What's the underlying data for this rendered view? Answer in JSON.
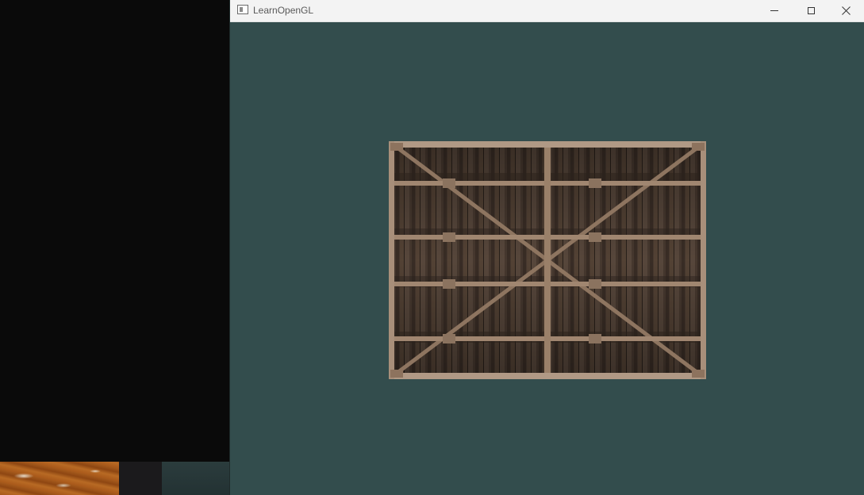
{
  "window": {
    "title": "LearnOpenGL",
    "controls": {
      "minimize": "minimize",
      "maximize": "maximize",
      "close": "close"
    }
  },
  "colors": {
    "clear_color": "#334d4d",
    "titlebar": "#f3f3f3",
    "desktop": "#0a0a0a"
  },
  "scene": {
    "object": "wooden-container-texture"
  }
}
